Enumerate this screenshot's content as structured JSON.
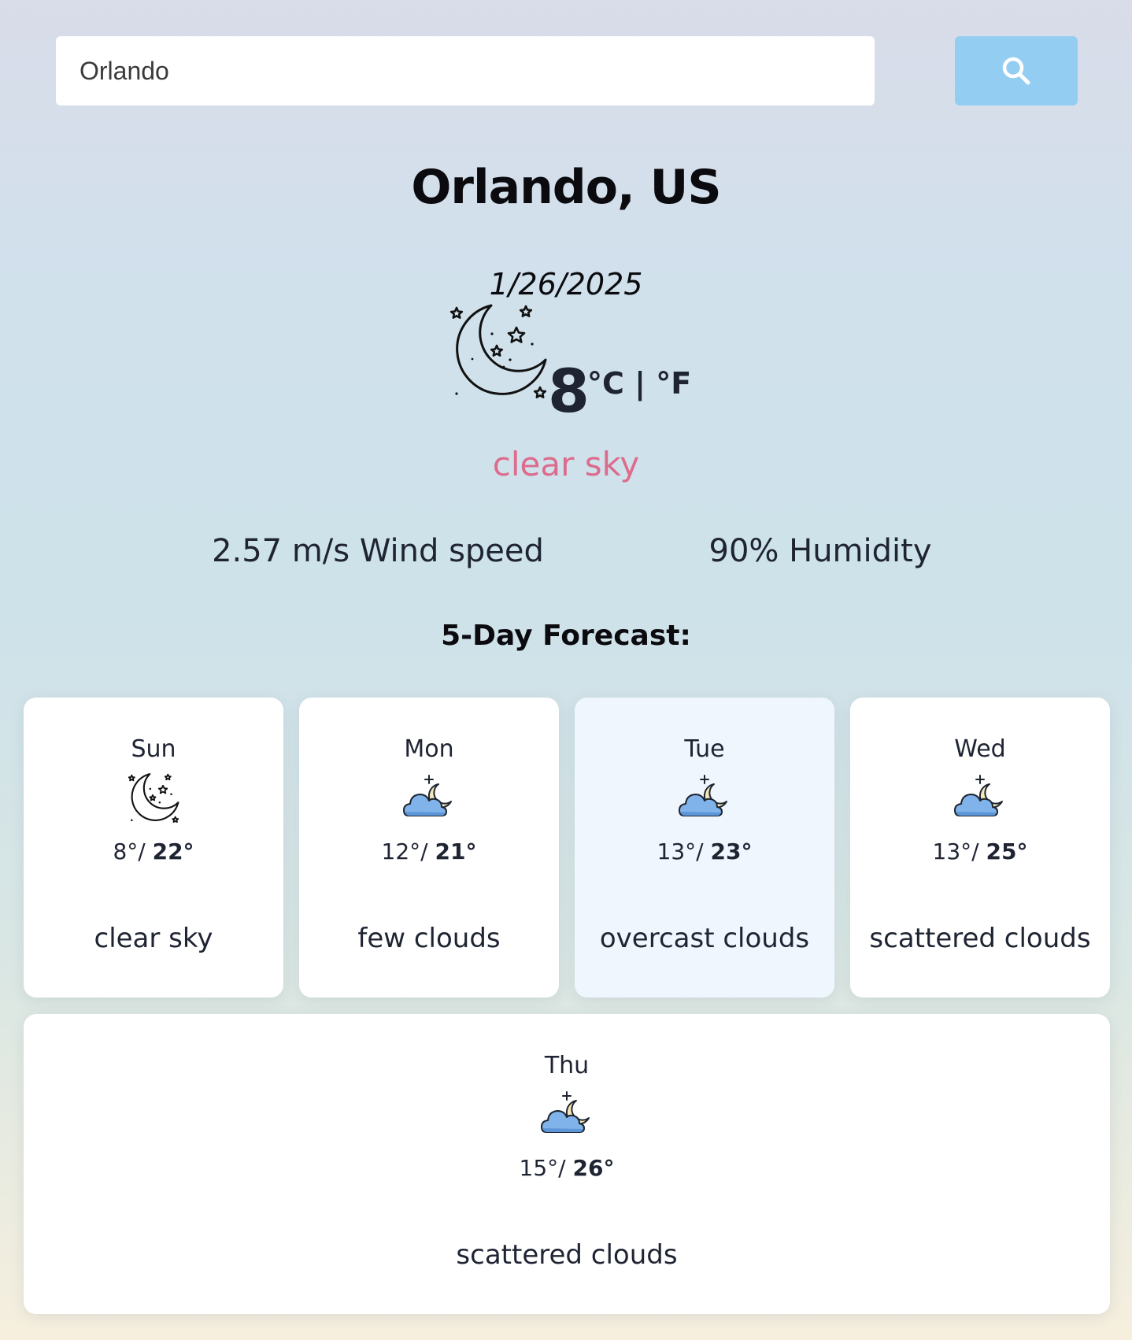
{
  "search": {
    "value": "Orlando",
    "icon": "search-icon",
    "button_color": "#94cdf2"
  },
  "current": {
    "location": "Orlando, US",
    "date": "1/26/2025",
    "icon": "moon-stars-icon",
    "temperature": "8",
    "units": "°C | °F",
    "description": "clear sky",
    "description_color": "#dd6b8c",
    "wind": "2.57 m/s Wind speed",
    "humidity": "90% Humidity"
  },
  "forecast": {
    "heading": "5-Day Forecast:",
    "days": [
      {
        "day": "Sun",
        "icon": "moon-stars-icon",
        "low": "8°/",
        "high": "22°",
        "description": "clear sky",
        "highlighted": false
      },
      {
        "day": "Mon",
        "icon": "cloud-moon-icon",
        "low": "12°/",
        "high": "21°",
        "description": "few clouds",
        "highlighted": false
      },
      {
        "day": "Tue",
        "icon": "cloud-moon-icon",
        "low": "13°/",
        "high": "23°",
        "description": "overcast clouds",
        "highlighted": true
      },
      {
        "day": "Wed",
        "icon": "cloud-moon-icon",
        "low": "13°/",
        "high": "25°",
        "description": "scattered clouds",
        "highlighted": false
      },
      {
        "day": "Thu",
        "icon": "cloud-moon-icon",
        "low": "15°/",
        "high": "26°",
        "description": "scattered clouds",
        "highlighted": false
      }
    ]
  }
}
